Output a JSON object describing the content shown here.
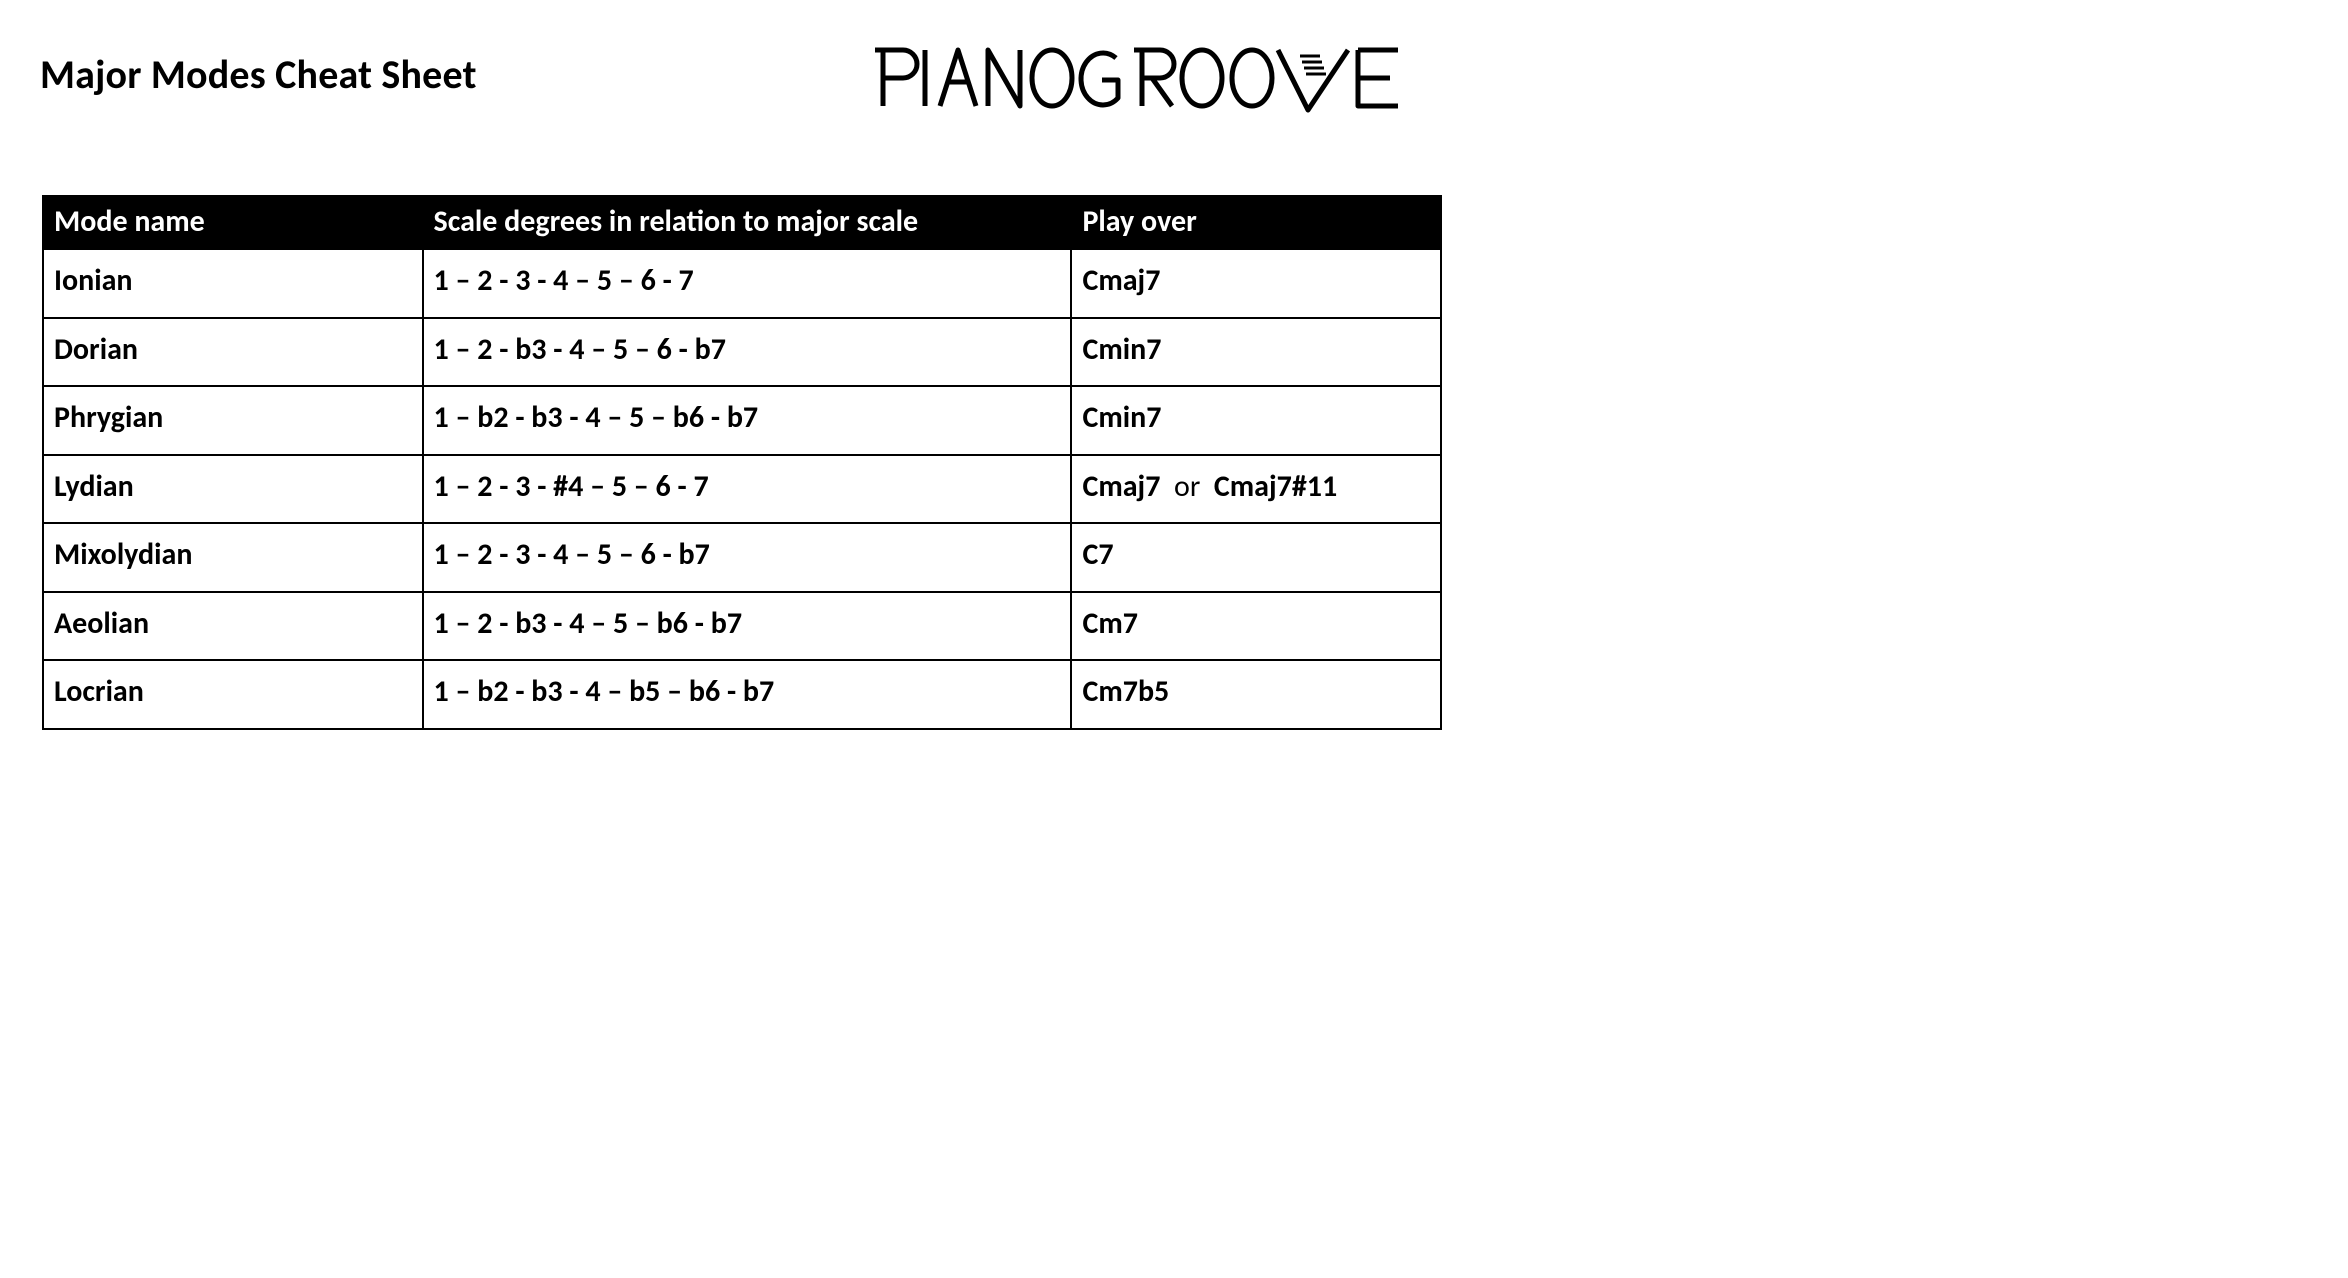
{
  "title": "Major Modes Cheat Sheet",
  "logo_text": "PIANOGROOVE",
  "columns": [
    "Mode name",
    "Scale degrees in relation to major scale",
    "Play over"
  ],
  "rows": [
    {
      "mode": "Ionian",
      "degrees": "1 – 2 - 3 - 4 – 5 – 6 - 7",
      "play_over": "Cmaj7"
    },
    {
      "mode": "Dorian",
      "degrees": "1 – 2 - b3 - 4 – 5 – 6 - b7",
      "play_over": "Cmin7"
    },
    {
      "mode": "Phrygian",
      "degrees": "1 – b2 - b3 - 4 – 5 – b6 - b7",
      "play_over": "Cmin7"
    },
    {
      "mode": "Lydian",
      "degrees": "1 – 2 - 3 - #4 – 5 – 6 - 7",
      "play_over_parts": [
        "Cmaj7",
        "or",
        "Cmaj7#11"
      ]
    },
    {
      "mode": "Mixolydian",
      "degrees": "1 – 2 - 3 - 4 – 5 – 6 - b7",
      "play_over": "C7"
    },
    {
      "mode": "Aeolian",
      "degrees": "1 – 2 - b3 - 4 – 5 – b6 - b7",
      "play_over": "Cm7"
    },
    {
      "mode": "Locrian",
      "degrees": "1 – b2 - b3 - 4 – b5 – b6 - b7",
      "play_over": "Cm7b5"
    }
  ]
}
